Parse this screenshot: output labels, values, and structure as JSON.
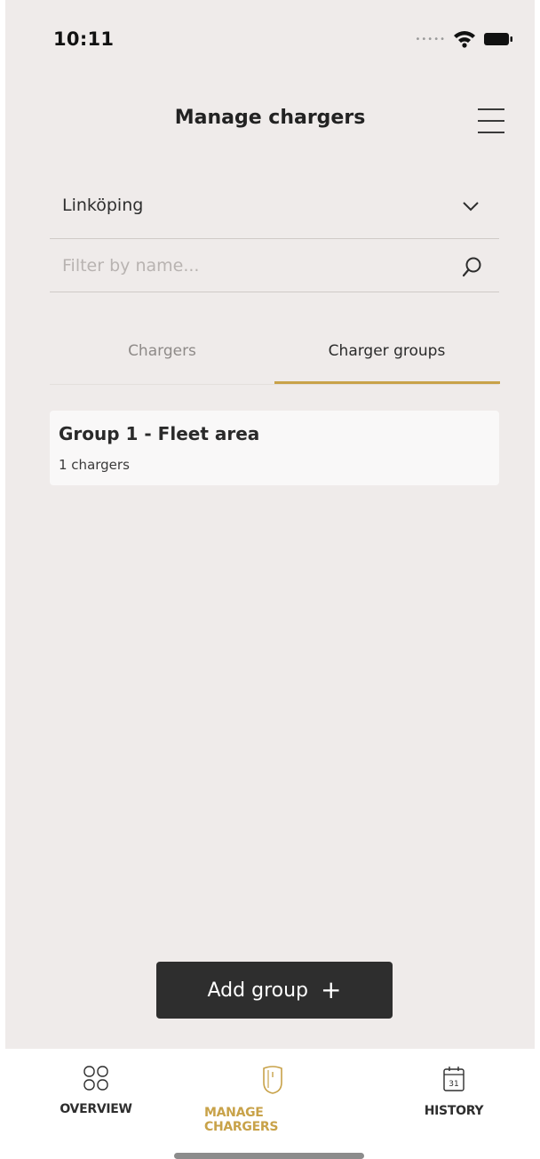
{
  "status_bar": {
    "time": "10:11",
    "signal_icon": "signal-dots-icon",
    "wifi_icon": "wifi-icon",
    "battery_icon": "battery-icon"
  },
  "header": {
    "title": "Manage chargers",
    "menu_icon": "hamburger-menu-icon"
  },
  "location_select": {
    "value": "Linköping",
    "icon": "chevron-down-icon"
  },
  "search": {
    "placeholder": "Filter by name...",
    "value": "",
    "icon": "search-icon"
  },
  "tabs": [
    {
      "label": "Chargers",
      "active": false
    },
    {
      "label": "Charger groups",
      "active": true
    }
  ],
  "groups": [
    {
      "name": "Group 1 - Fleet area",
      "count_text": "1 chargers"
    }
  ],
  "add_group_button": {
    "label": "Add group",
    "icon": "plus-icon",
    "icon_glyph": "+"
  },
  "bottom_nav": [
    {
      "label": "OVERVIEW",
      "icon": "overview-grid-icon",
      "active": false
    },
    {
      "label": "MANAGE CHARGERS",
      "icon": "charger-icon",
      "active": true
    },
    {
      "label": "HISTORY",
      "icon": "calendar-icon",
      "icon_text": "31",
      "active": false
    }
  ],
  "colors": {
    "accent": "#c8a249",
    "background": "#efebea",
    "button_dark": "#2e2e2e",
    "card": "#f9f8f8"
  }
}
